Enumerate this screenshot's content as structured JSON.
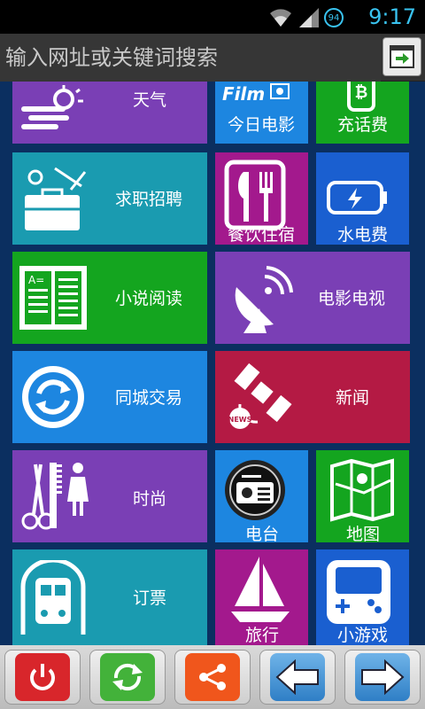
{
  "status": {
    "time": "9:17",
    "battery": "94"
  },
  "search": {
    "placeholder": "输入网址或关键词搜索"
  },
  "tiles": {
    "weather": "天气",
    "movie_today": "今日电影",
    "film_logo": "Film",
    "recharge": "充话费",
    "jobs": "求职招聘",
    "dining": "餐饮住宿",
    "utilities": "水电费",
    "novels": "小说阅读",
    "tv": "电影电视",
    "exchange": "同城交易",
    "news": "新闻",
    "news_badge": "NEWS",
    "fashion": "时尚",
    "radio": "电台",
    "map": "地图",
    "tickets": "订票",
    "travel": "旅行",
    "games": "小游戏"
  },
  "colors": {
    "purple": "#7a3fb5",
    "teal": "#1a9bb0",
    "blue": "#1d86e0",
    "green": "#14a51f",
    "magenta": "#a3198d",
    "crimson": "#b41a44",
    "background": "#0b2f60"
  },
  "icons": [
    "wifi-icon",
    "signal-icon",
    "go-icon",
    "power-icon",
    "refresh-icon",
    "share-icon",
    "back-arrow-icon",
    "forward-arrow-icon"
  ]
}
